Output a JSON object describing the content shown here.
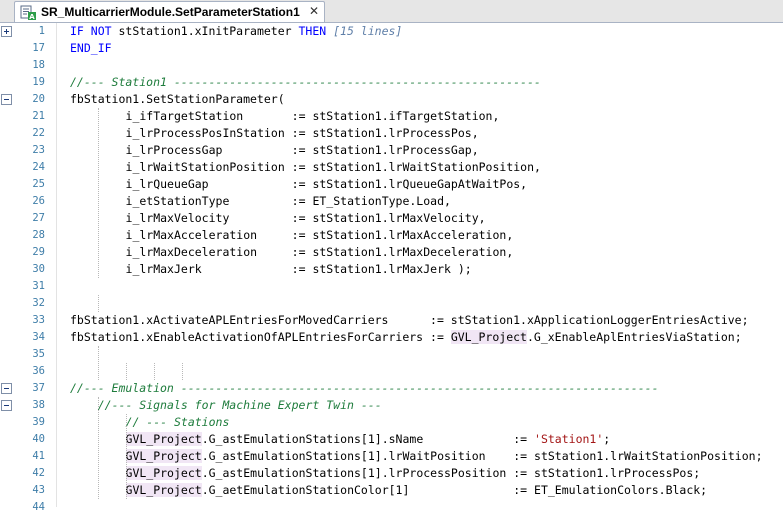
{
  "tab": {
    "title": "SR_MulticarrierModule.SetParameterStation1",
    "close": "✕"
  },
  "colors": {
    "keyword": "#0000ff",
    "comment": "#1e7c3c",
    "string": "#a31515",
    "highlight": "#f1e6f5",
    "line_number": "#3e7da8"
  },
  "lines": [
    {
      "no": "1",
      "fold": "expand",
      "indent": 0,
      "tokens": [
        [
          "kw",
          "IF NOT "
        ],
        [
          "",
          "stStation1.xInitParameter "
        ],
        [
          "kw",
          "THEN "
        ],
        [
          "fold-ann",
          "[15 lines]"
        ]
      ]
    },
    {
      "no": "17",
      "indent": 0,
      "tokens": [
        [
          "kw",
          "END_IF"
        ]
      ]
    },
    {
      "no": "18",
      "indent": 0,
      "tokens": []
    },
    {
      "no": "19",
      "indent": 0,
      "tokens": [
        [
          "cm",
          "//--- Station1 -----------------------------------------------------"
        ]
      ]
    },
    {
      "no": "20",
      "fold": "collapse",
      "indent": 0,
      "tokens": [
        [
          "",
          "fbStation1.SetStationParameter("
        ]
      ]
    },
    {
      "no": "21",
      "indent": 8,
      "tokens": [
        [
          "",
          "i_ifTargetStation       := stStation1.ifTargetStation,"
        ]
      ]
    },
    {
      "no": "22",
      "indent": 8,
      "tokens": [
        [
          "",
          "i_lrProcessPosInStation := stStation1.lrProcessPos,"
        ]
      ]
    },
    {
      "no": "23",
      "indent": 8,
      "tokens": [
        [
          "",
          "i_lrProcessGap          := stStation1.lrProcessGap,"
        ]
      ]
    },
    {
      "no": "24",
      "indent": 8,
      "tokens": [
        [
          "",
          "i_lrWaitStationPosition := stStation1.lrWaitStationPosition,"
        ]
      ]
    },
    {
      "no": "25",
      "indent": 8,
      "tokens": [
        [
          "",
          "i_lrQueueGap            := stStation1.lrQueueGapAtWaitPos,"
        ]
      ]
    },
    {
      "no": "26",
      "indent": 8,
      "tokens": [
        [
          "",
          "i_etStationType         := ET_StationType.Load,"
        ]
      ]
    },
    {
      "no": "27",
      "indent": 8,
      "tokens": [
        [
          "",
          "i_lrMaxVelocity         := stStation1.lrMaxVelocity,"
        ]
      ]
    },
    {
      "no": "28",
      "indent": 8,
      "tokens": [
        [
          "",
          "i_lrMaxAcceleration     := stStation1.lrMaxAcceleration,"
        ]
      ]
    },
    {
      "no": "29",
      "indent": 8,
      "tokens": [
        [
          "",
          "i_lrMaxDeceleration     := stStation1.lrMaxDeceleration,"
        ]
      ]
    },
    {
      "no": "30",
      "indent": 8,
      "tokens": [
        [
          "",
          "i_lrMaxJerk             := stStation1.lrMaxJerk );"
        ]
      ]
    },
    {
      "no": "31",
      "indent": 0,
      "tokens": []
    },
    {
      "no": "32",
      "indent": 0,
      "tokens": []
    },
    {
      "no": "33",
      "indent": 0,
      "tokens": [
        [
          "",
          "fbStation1.xActivateAPLEntriesForMovedCarriers      := stStation1.xApplicationLoggerEntriesActive;"
        ]
      ]
    },
    {
      "no": "34",
      "indent": 0,
      "tokens": [
        [
          "",
          "fbStation1.xEnableActivationOfAPLEntriesForCarriers := "
        ],
        [
          "hl",
          "GVL_Project"
        ],
        [
          "",
          ".G_xEnableAplEntriesViaStation;"
        ]
      ]
    },
    {
      "no": "35",
      "indent": 0,
      "tokens": []
    },
    {
      "no": "36",
      "indent": 0,
      "tokens": []
    },
    {
      "no": "37",
      "fold": "collapse",
      "indent": 0,
      "tokens": [
        [
          "cm",
          "//--- Emulation ---------------------------------------------------------------------"
        ]
      ]
    },
    {
      "no": "38",
      "fold": "collapse",
      "indent": 4,
      "tokens": [
        [
          "cm",
          "//--- Signals for Machine Expert Twin ---"
        ]
      ]
    },
    {
      "no": "39",
      "indent": 8,
      "tokens": [
        [
          "cm",
          "// --- Stations"
        ]
      ]
    },
    {
      "no": "40",
      "indent": 8,
      "tokens": [
        [
          "hl",
          "GVL_Project"
        ],
        [
          "",
          ".G_astEmulationStations[1].sName             := "
        ],
        [
          "str",
          "'Station1'"
        ],
        [
          "",
          ";"
        ]
      ]
    },
    {
      "no": "41",
      "indent": 8,
      "tokens": [
        [
          "hl",
          "GVL_Project"
        ],
        [
          "",
          ".G_astEmulationStations[1].lrWaitPosition    := stStation1.lrWaitStationPosition;"
        ]
      ]
    },
    {
      "no": "42",
      "indent": 8,
      "tokens": [
        [
          "hl",
          "GVL_Project"
        ],
        [
          "",
          ".G_astEmulationStations[1].lrProcessPosition := stStation1.lrProcessPos;"
        ]
      ]
    },
    {
      "no": "43",
      "indent": 8,
      "tokens": [
        [
          "hl",
          "GVL_Project"
        ],
        [
          "",
          ".G_aetEmulationStationColor[1]               := ET_EmulationColors.Black;"
        ]
      ]
    },
    {
      "no": "44",
      "indent": 0,
      "tokens": []
    }
  ]
}
